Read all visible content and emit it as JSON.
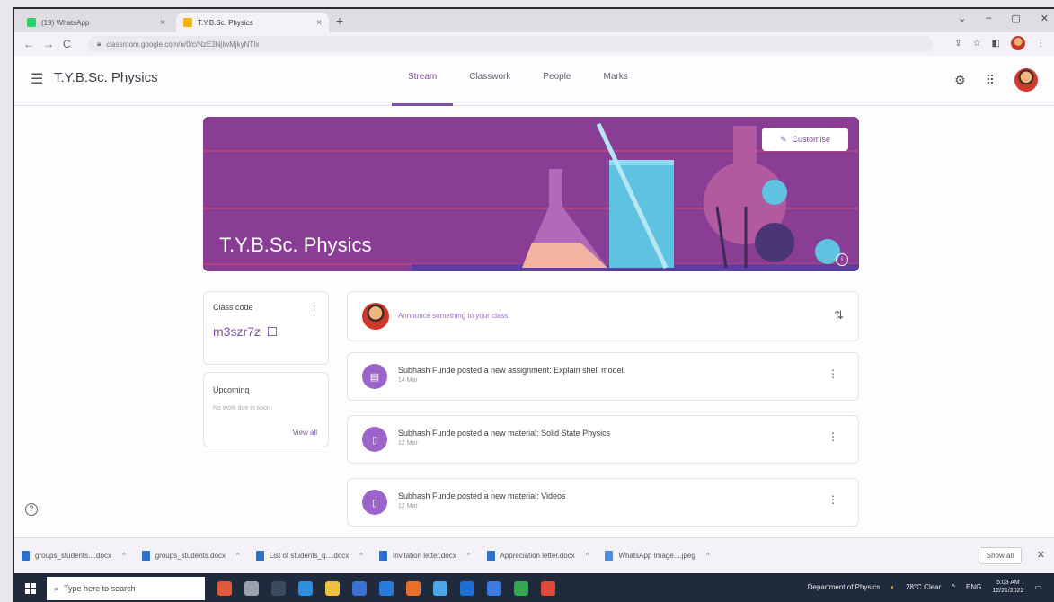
{
  "browser": {
    "tabs": [
      {
        "label": "(19) WhatsApp",
        "icon": "whatsapp-icon",
        "color": "#25d366"
      },
      {
        "label": "T.Y.B.Sc. Physics",
        "icon": "classroom-icon",
        "color": "#f4b400"
      }
    ],
    "url": "classroom.google.com/u/0/c/NzE3NjIwMjkyNTIx"
  },
  "header": {
    "class_title": "T.Y.B.Sc. Physics",
    "tabs": [
      "Stream",
      "Classwork",
      "People",
      "Marks"
    ],
    "active_tab": "Stream"
  },
  "banner": {
    "title": "T.Y.B.Sc. Physics",
    "customise_label": "Customise",
    "color": "#8a3d94"
  },
  "class_code": {
    "label": "Class code",
    "code": "m3szr7z"
  },
  "upcoming": {
    "label": "Upcoming",
    "empty_text": "No work due in soon",
    "view_all": "View all"
  },
  "announce": {
    "placeholder": "Announce something to your class"
  },
  "posts": [
    {
      "title": "Subhash Funde posted a new assignment: Explain shell model.",
      "date": "14 Mar",
      "icon": "assignment-icon"
    },
    {
      "title": "Subhash Funde posted a new material: Solid State Physics",
      "date": "12 Mar",
      "icon": "material-icon"
    },
    {
      "title": "Subhash Funde posted a new material: Videos",
      "date": "12 Mar",
      "icon": "material-icon"
    }
  ],
  "downloads": {
    "items": [
      "groups_students....docx",
      "groups_students.docx",
      "List of students_q....docx",
      "Invitation letter.docx",
      "Appreciation letter.docx",
      "WhatsApp Image....jpeg"
    ],
    "show_all": "Show all"
  },
  "taskbar": {
    "search_placeholder": "Type here to search",
    "tray_label": "Department of Physics",
    "weather": "28°C Clear",
    "lang": "ENG",
    "time": "5:03 AM",
    "date": "12/21/2022"
  },
  "colors": {
    "accent": "#7b4fa3",
    "banner": "#8a3d94"
  }
}
